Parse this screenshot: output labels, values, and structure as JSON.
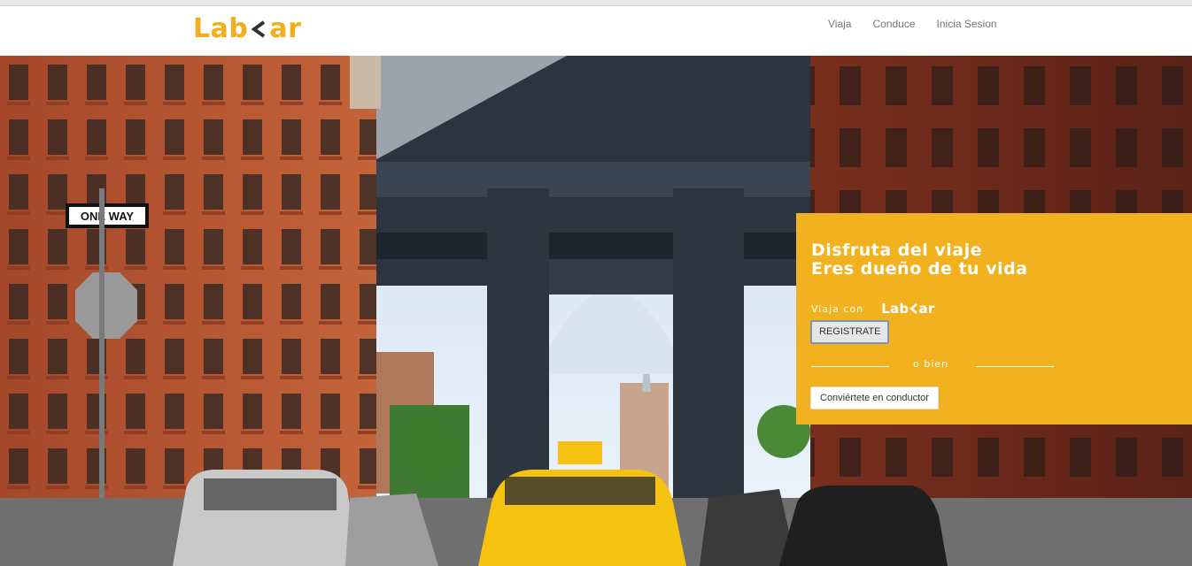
{
  "brand": {
    "name_left": "Lab",
    "name_right": "ar",
    "color": "#f2ae1c"
  },
  "nav": {
    "items": [
      {
        "label": "Viaja"
      },
      {
        "label": "Conduce"
      },
      {
        "label": "Inicia Sesion"
      }
    ]
  },
  "hero": {
    "image": "city-street-bridge-taxi",
    "sign_text": "ONE WAY"
  },
  "panel": {
    "background": "#f2b11e",
    "headline_1": "Disfruta del viaje",
    "headline_2": "Eres dueño de tu vida",
    "viaja_label": "Viaja con",
    "viaja_brand_left": "Lab",
    "viaja_brand_right": "ar",
    "register_button": "REGISTRATE",
    "or_text": "o bien",
    "driver_button": "Conviértete en conductor"
  }
}
